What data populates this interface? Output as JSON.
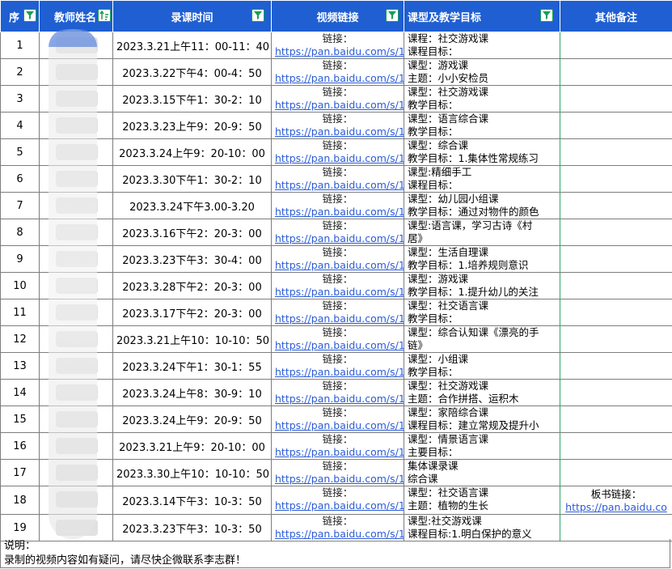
{
  "headers": [
    {
      "label": "序"
    },
    {
      "label": "教师姓名"
    },
    {
      "label": "录课时间"
    },
    {
      "label": "视频链接"
    },
    {
      "label": "课型及教学目标"
    },
    {
      "label": "其他备注"
    }
  ],
  "rows": [
    {
      "no": "1",
      "time": "2023.3.21上午11：00-11：40",
      "link1": "链接：",
      "link2": "https://pan.baidu.com/s/1i",
      "g1": "课程：社交游戏课",
      "g2": "课程目标：",
      "note1": "",
      "note2": ""
    },
    {
      "no": "2",
      "time": "2023.3.22下午4：00-4：50",
      "link1": "链接：",
      "link2": "https://pan.baidu.com/s/1",
      "g1": "课型：游戏课",
      "g2": "主题：小小安检员",
      "note1": "",
      "note2": ""
    },
    {
      "no": "3",
      "time": "2023.3.15下午1：30-2：10",
      "link1": "链接：",
      "link2": "https://pan.baidu.com/s/1",
      "g1": "课型：社交游戏课",
      "g2": "教学目标：",
      "note1": "",
      "note2": ""
    },
    {
      "no": "4",
      "time": "2023.3.23上午9：20-9：50",
      "link1": "链接：",
      "link2": "https://pan.baidu.com/s/1",
      "g1": "课型：语言综合课",
      "g2": "教学目标：",
      "note1": "",
      "note2": ""
    },
    {
      "no": "5",
      "time": "2023.3.24上午9：20-10：00",
      "link1": "链接：",
      "link2": "https://pan.baidu.com/s/1",
      "g1": "课型：综合课",
      "g2": "教学目标：1.集体性常规练习",
      "note1": "",
      "note2": ""
    },
    {
      "no": "6",
      "time": "2023.3.30下午1：30-2：10",
      "link1": "链接：",
      "link2": "https://pan.baidu.com/s/1",
      "g1": "课型:精细手工",
      "g2": "课程目标：",
      "note1": "",
      "note2": ""
    },
    {
      "no": "7",
      "time": "2023.3.24下午3.00-3.20",
      "link1": "链接：",
      "link2": "https://pan.baidu.com/s/1",
      "g1": "课型：幼儿园小组课",
      "g2": "教学目标：通过对物件的颜色",
      "note1": "",
      "note2": ""
    },
    {
      "no": "8",
      "time": "2023.3.16下午2：20-3：00",
      "link1": "链接：",
      "link2": "https://pan.baidu.com/s/1",
      "g1": "课型:语言课，学习古诗《村",
      "g2": "居》",
      "note1": "",
      "note2": ""
    },
    {
      "no": "9",
      "time": "2023.3.23下午3：30-4：00",
      "link1": "链接：",
      "link2": "https://pan.baidu.com/s/1",
      "g1": "课型：生活自理课",
      "g2": "教学目标：1.培养规则意识",
      "note1": "",
      "note2": ""
    },
    {
      "no": "10",
      "time": "2023.3.28下午2：20-3：00",
      "link1": "链接：",
      "link2": "https://pan.baidu.com/s/1",
      "g1": "课型：游戏课",
      "g2": "教学目标：1.提升幼儿的关注",
      "note1": "",
      "note2": ""
    },
    {
      "no": "11",
      "time": "2023.3.17下午2：20-3：00",
      "link1": "链接：",
      "link2": "https://pan.baidu.com/s/1",
      "g1": "课型：社交语言课",
      "g2": "教学目标：",
      "note1": "",
      "note2": ""
    },
    {
      "no": "12",
      "time": "2023.3.21上午10：10-10：50",
      "link1": "链接：",
      "link2": "https://pan.baidu.com/s/1",
      "g1": "课型：综合认知课《漂亮的手",
      "g2": "链》",
      "note1": "",
      "note2": ""
    },
    {
      "no": "13",
      "time": "2023.3.24下午1：30-1：55",
      "link1": "链接：",
      "link2": "https://pan.baidu.com/s/1",
      "g1": "课型：小组课",
      "g2": "教学目标：",
      "note1": "",
      "note2": ""
    },
    {
      "no": "14",
      "time": "2023.3.24上午8：30-9：10",
      "link1": "链接：",
      "link2": "https://pan.baidu.com/s/1",
      "g1": "课型：社交游戏课",
      "g2": "主题：合作拼搭、运积木",
      "note1": "",
      "note2": ""
    },
    {
      "no": "15",
      "time": "2023.3.24上午9：20-9：50",
      "link1": "链接：",
      "link2": "https://pan.baidu.com/s/1",
      "g1": "课型：家陪综合课",
      "g2": "课程目标：建立常规及提升小",
      "note1": "",
      "note2": ""
    },
    {
      "no": "16",
      "time": "2023.3.21上午9：20-10：00",
      "link1": "链接：",
      "link2": "https://pan.baidu.com/s/1",
      "g1": "课型：情景语言课",
      "g2": "主要目标：",
      "note1": "",
      "note2": ""
    },
    {
      "no": "17",
      "time": "2023.3.30上午10：10-10：50",
      "link1": "链接：",
      "link2": "https://pan.baidu.com/s/1",
      "g1": "集体课录课",
      "g2": "综合课",
      "note1": "",
      "note2": ""
    },
    {
      "no": "18",
      "time": "2023.3.14下午3：10-3：50",
      "link1": "链接：",
      "link2": "https://pan.baidu.com/s/1",
      "g1": "课型：社交语言课",
      "g2": "主题：植物的生长",
      "note1": "板书链接：",
      "note2": "https://pan.baidu.co"
    },
    {
      "no": "19",
      "time": "2023.3.23下午3：10-3：50",
      "link1": "链接：",
      "link2": "https://pan.baidu.com/s/1",
      "g1": "课型:社交游戏课",
      "g2": "课程目标:1.明白保护的意义",
      "note1": "",
      "note2": ""
    }
  ],
  "footer": {
    "line1": "说明：",
    "line2": "录制的视频内容如有疑问，请尽快企微联系李志群！"
  },
  "colors": {
    "header_bg": "#1f5fd2",
    "link": "#2a5bd7",
    "filter_icon": "#1a9e57"
  }
}
